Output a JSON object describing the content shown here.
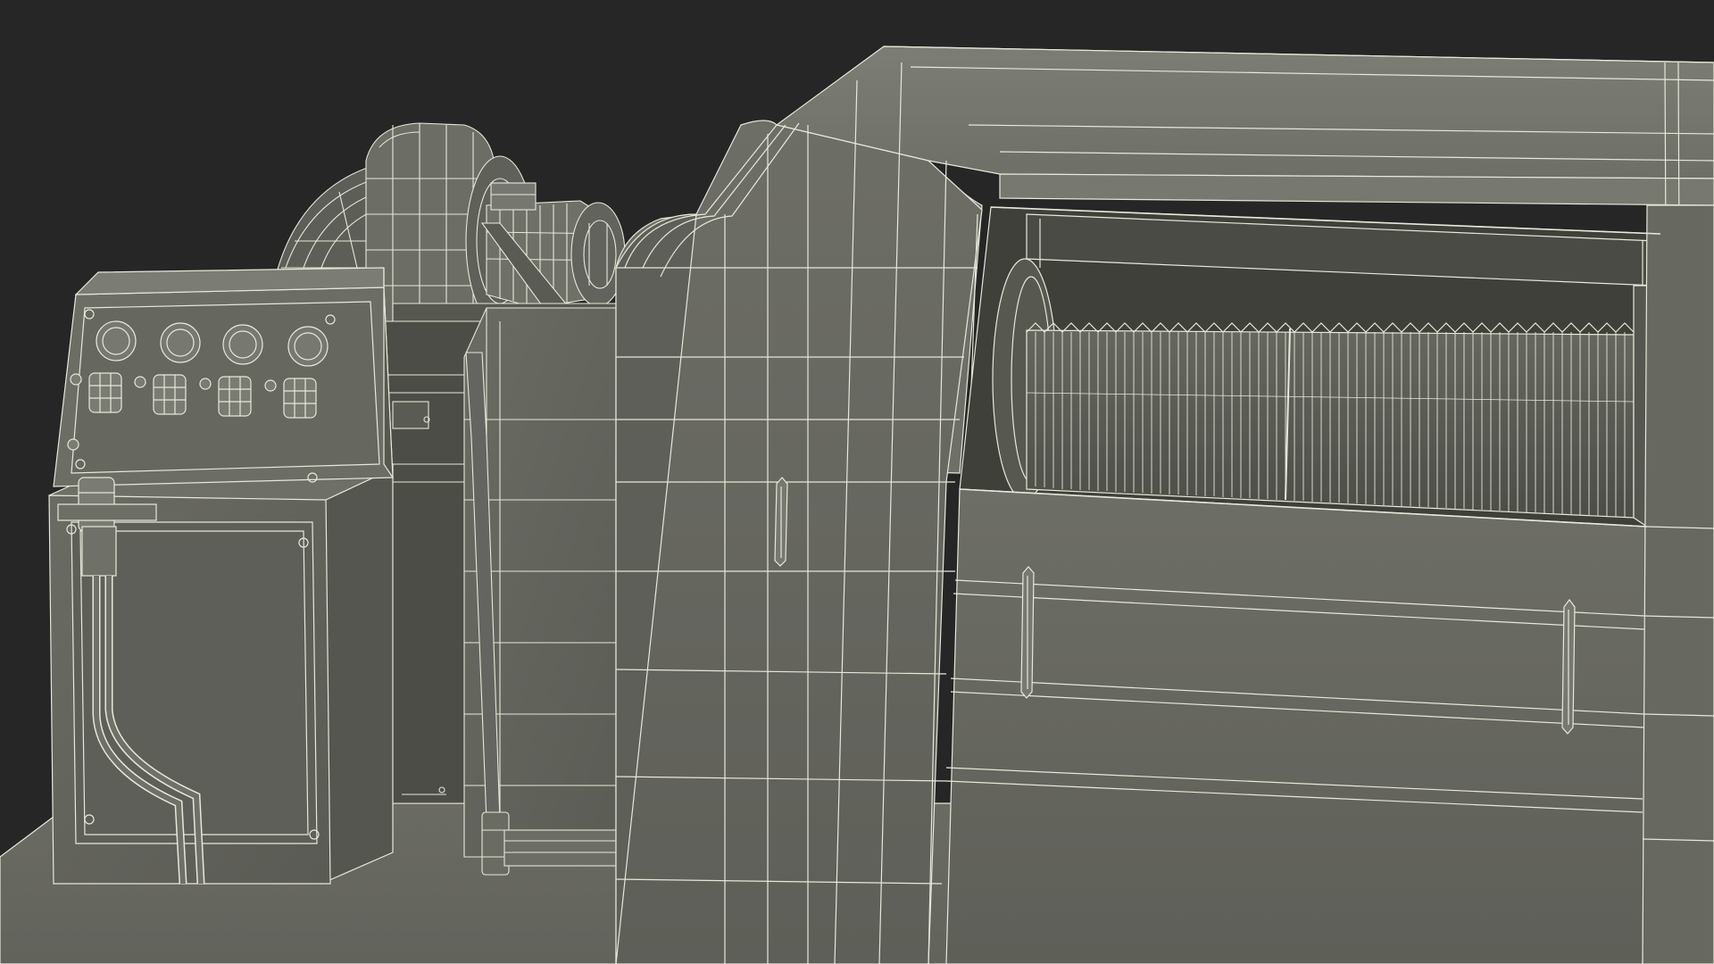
{
  "scene": {
    "subject": "wireframe-winch-model",
    "colors": {
      "background": "#262626",
      "surface": "#6b6c64",
      "surface_light": "#74756c",
      "surface_dark": "#55564f",
      "surface_darker": "#45463f",
      "cavity": "#3f403a",
      "drum": "#5b5c55",
      "wire": "#e6e8da"
    },
    "icons": {
      "gauge": "gauge-icon",
      "switch": "rotary-switch-icon",
      "bolt": "bolt-icon",
      "handle": "handle-icon"
    }
  }
}
